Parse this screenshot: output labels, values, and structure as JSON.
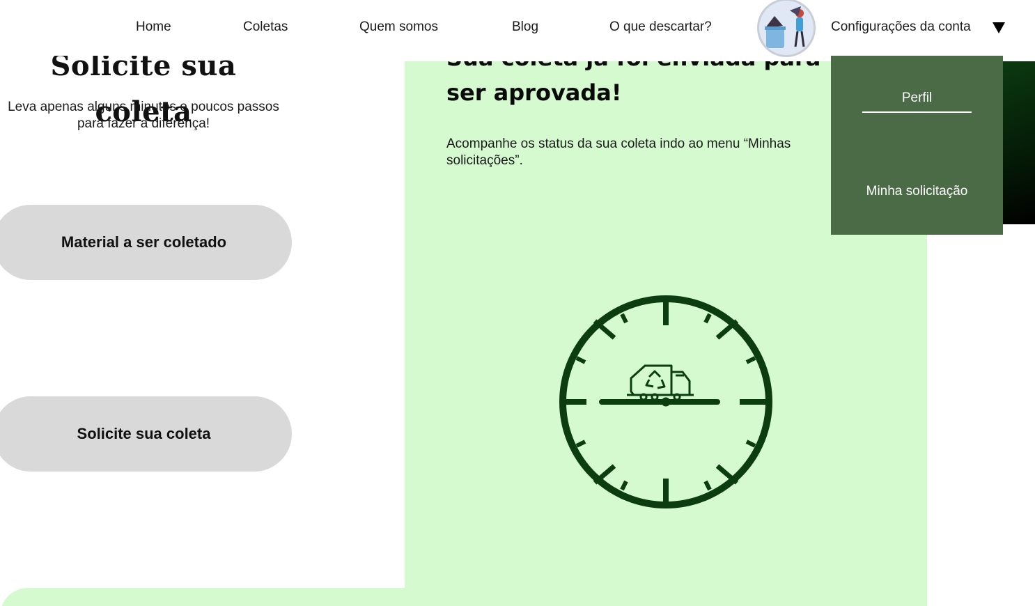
{
  "nav": {
    "home": "Home",
    "coletas": "Coletas",
    "quem_somos": "Quem somos",
    "blog": "Blog",
    "o_que_descartar": "O que descartar?",
    "account_label": "Configurações da conta"
  },
  "dropdown": {
    "perfil": "Perfil",
    "minha_solicitacao": "Minha solicitação"
  },
  "left": {
    "title": "Solicite sua coleta",
    "subtitle": "Leva apenas alguns minutos e poucos passos para fazer a diferença!",
    "button_material": "Material a ser coletado",
    "button_solicite": "Solicite sua coleta"
  },
  "panel": {
    "title": "Sua coleta já foi enviada para ser aprovada!",
    "text": "Acompanhe os status da sua coleta indo ao menu “Minhas solicitações”."
  },
  "colors": {
    "panel_bg": "#d6fad0",
    "dropdown_bg": "#4a6b46",
    "clock_green": "#0b3d10",
    "pill_bg": "#d9d9d9"
  },
  "icons": {
    "avatar": "avatar-illustration",
    "caret": "caret-down-icon",
    "clock": "clock-truck-icon"
  }
}
